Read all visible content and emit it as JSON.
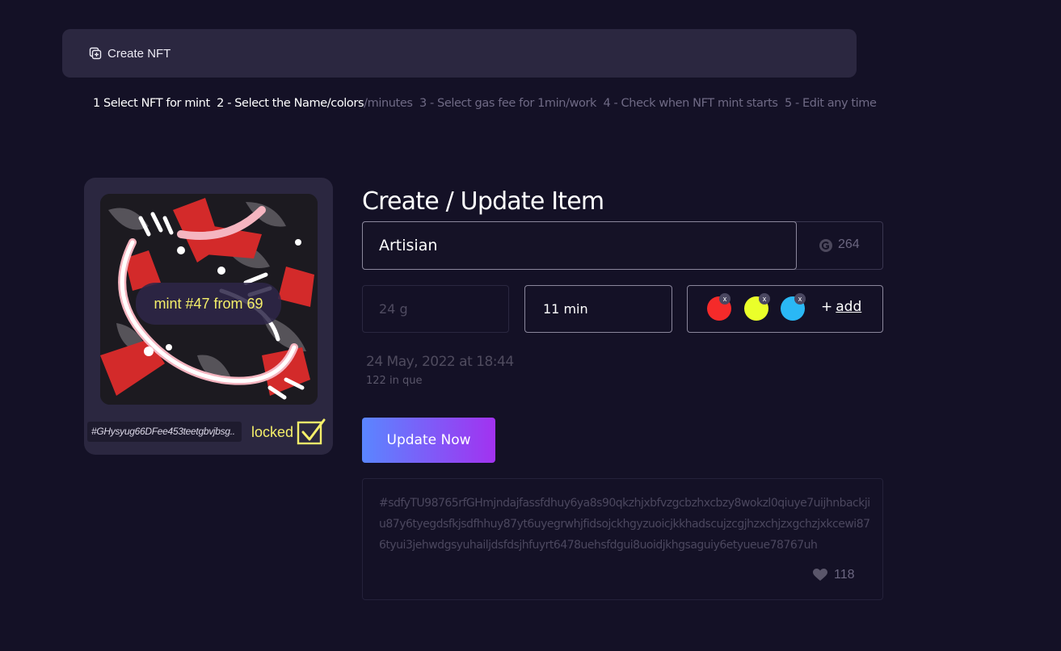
{
  "header": {
    "title": "Create NFT",
    "icon": "add-square-icon"
  },
  "steps": {
    "s1": "1  Select NFT for mint",
    "s2": "2 - Select the Name/colors",
    "s2b": "/minutes",
    "s3": "3 - Select gas fee for 1min/work",
    "s4": "4 - Check when NFT mint starts",
    "s5": "5 - Edit any time"
  },
  "preview": {
    "mint_label": "mint #47 from 69",
    "hash": "#GHysyug66DFee453teetgbvjbsg..",
    "locked_label": "locked",
    "accent": "#f5ef6a"
  },
  "form": {
    "title": "Create / Update Item",
    "name_value": "Artisian",
    "gas_value": "264",
    "weight_value": "24 g",
    "minutes_value": "11 min",
    "colors": [
      "#f52a2a",
      "#eaff2a",
      "#2ab8f5"
    ],
    "remove_label": "x",
    "add_plus": "+",
    "add_label": "add",
    "date": "24 May, 2022 at 18:44",
    "queue_count": "122",
    "queue_suffix": "in que",
    "update_button": "Update Now"
  },
  "hashbox": {
    "text": "#sdfyTU98765rfGHmjndajfassfdhuy6ya8s90qkzhjxbfvzgcbzhxcbzy8wokzl0qiuye7uijhnbackjiu87y6tyegdsfkjsdfhhuy87yt6uyegrwhjfidsojckhgyzuoicjkkhadscujzcgjhzxchjzxgchzjxkcewi876tyui3jehwdgsyuhailjdsfdsjhfuyrt6478uehsfdgui8uoidjkhgsaguiy6etyueue78767uh",
    "likes": "118"
  }
}
